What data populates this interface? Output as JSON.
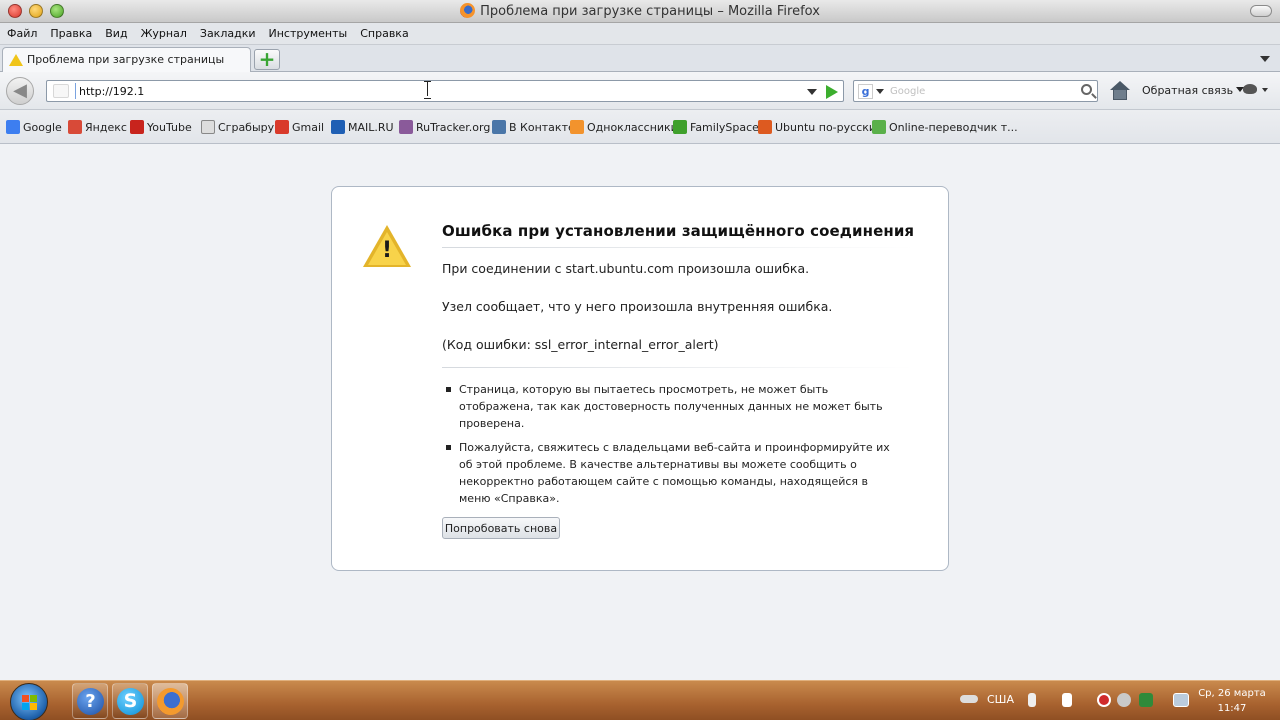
{
  "window": {
    "title": "Проблема при загрузке страницы – Mozilla Firefox"
  },
  "menu": {
    "items": [
      "Файл",
      "Правка",
      "Вид",
      "Журнал",
      "Закладки",
      "Инструменты",
      "Справка"
    ]
  },
  "tabs": {
    "active_label": "Проблема при загрузке страницы",
    "new_tab_symbol": "+"
  },
  "nav": {
    "back_symbol": "◀",
    "url_value": "http://192.1",
    "search_engine_letter": "g",
    "search_placeholder": "Google",
    "feedback_label": "Обратная связь"
  },
  "bookmarks": {
    "items": [
      {
        "label": "Google",
        "icon": "google-icon"
      },
      {
        "label": "Яндекс",
        "icon": "yandex-icon"
      },
      {
        "label": "YouTube",
        "icon": "youtube-icon"
      },
      {
        "label": "Сграбыру",
        "icon": "page-icon"
      },
      {
        "label": "Gmail",
        "icon": "gmail-icon"
      },
      {
        "label": "MAIL.RU",
        "icon": "mailru-icon"
      },
      {
        "label": "RuTracker.org",
        "icon": "rutracker-icon"
      },
      {
        "label": "В Контакте",
        "icon": "vkontakte-icon"
      },
      {
        "label": "Одноклассники",
        "icon": "odnoklassniki-icon"
      },
      {
        "label": "FamilySpace",
        "icon": "familyspace-icon"
      },
      {
        "label": "Ubuntu по-русски",
        "icon": "ubuntu-icon"
      },
      {
        "label": "Online-переводчик т...",
        "icon": "translator-icon"
      }
    ]
  },
  "error": {
    "title": "Ошибка при установлении защищённого соединения",
    "line1": "При соединении с start.ubuntu.com произошла ошибка.",
    "line2": "Узел сообщает, что у него произошла внутренняя ошибка.",
    "code_line": "(Код ошибки: ssl_error_internal_error_alert)",
    "warning_mark": "!",
    "bullets": [
      "Страница, которую вы пытаетесь просмотреть, не может быть отображена, так как достоверность полученных данных не может быть проверена.",
      "Пожалуйста, свяжитесь с владельцами веб-сайта и проинформируйте их об этой проблеме. В качестве альтернативы вы можете сообщить о некорректно работающем сайте с помощью команды, находящейся в меню «Справка»."
    ],
    "retry_label": "Попробовать снова"
  },
  "taskbar": {
    "help_symbol": "?",
    "skype_symbol": "S",
    "language": "США",
    "date": "Ср, 26 марта",
    "time": "11:47"
  },
  "colors": {
    "bookmark_icons": {
      "google-icon": "#3d7ef0",
      "yandex-icon": "#d84a38",
      "youtube-icon": "#c8241d",
      "page-icon": "#dddddd",
      "gmail-icon": "#d93a2b",
      "mailru-icon": "#1f5fb4",
      "rutracker-icon": "#8a5a9a",
      "vkontakte-icon": "#4a76a8",
      "odnoklassniki-icon": "#f2932d",
      "familyspace-icon": "#3fa02c",
      "ubuntu-icon": "#dd5a20",
      "translator-icon": "#5ab04a"
    }
  }
}
